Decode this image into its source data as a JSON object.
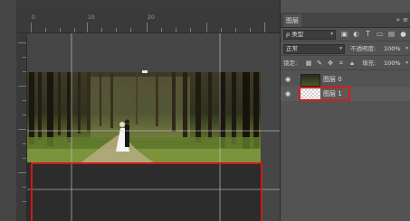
{
  "canvas": {
    "ruler_marks": [
      "0",
      "10",
      "20"
    ],
    "photo_description_icon": "wedding-photo-forest"
  },
  "panel": {
    "tab_label": "图层",
    "collapse_icon": "»",
    "menu_icon": "≡",
    "filter_kind": "ρ 类型",
    "filter_icons": [
      "image-icon",
      "adjustment-icon",
      "type-icon",
      "shape-icon",
      "smart-object-icon"
    ],
    "blend_mode": "正常",
    "opacity_label": "不透明度:",
    "opacity_value": "100%",
    "lock_label": "锁定:",
    "fill_label": "填充:",
    "fill_value": "100%",
    "layers": [
      {
        "name": "图层 0",
        "visible": true
      },
      {
        "name": "图层 1",
        "visible": true
      }
    ]
  },
  "colors": {
    "selection": "#cf1a1a",
    "panel_bg": "#535353",
    "canvas_bg": "#464646"
  }
}
